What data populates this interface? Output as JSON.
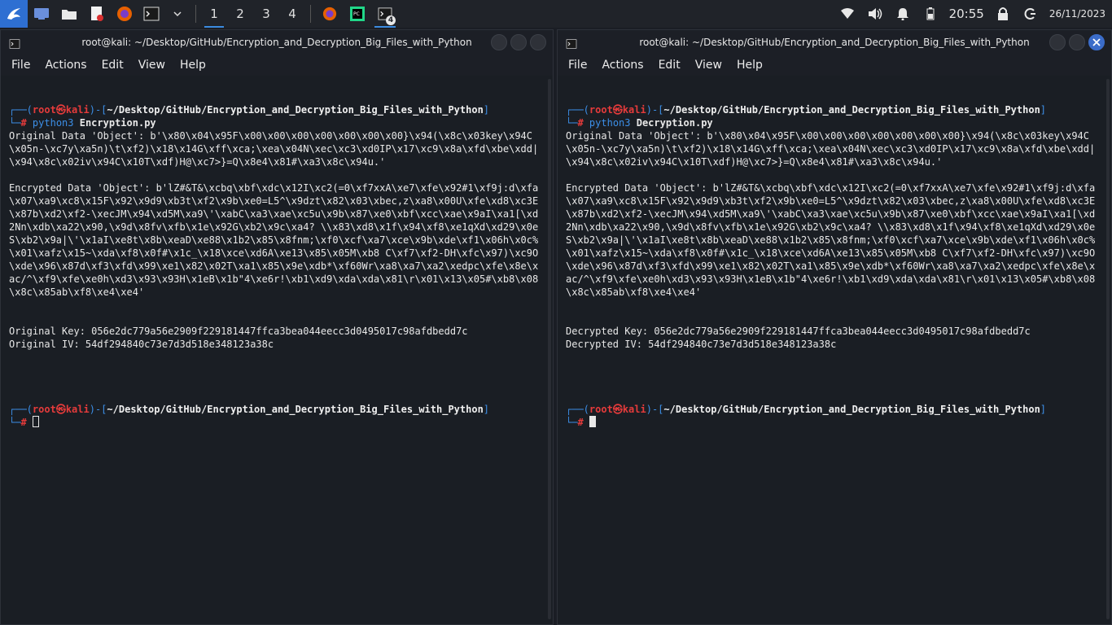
{
  "taskbar": {
    "workspaces": [
      "1",
      "2",
      "3",
      "4"
    ],
    "active_workspace": "1",
    "terminal_badge": "4",
    "clock": "20:55",
    "date": "26/11/2023"
  },
  "colors": {
    "taskbar_bg": "#202329",
    "terminal_bg": "#1b1e25",
    "prompt_blue": "#3c8fe8",
    "prompt_red": "#e53b3b",
    "accent": "#3b6cc9"
  },
  "left": {
    "title": "root@kali: ~/Desktop/GitHub/Encryption_and_Decryption_Big_Files_with_Python",
    "menu": [
      "File",
      "Actions",
      "Edit",
      "View",
      "Help"
    ],
    "prompt_user": "root",
    "prompt_host": "kali",
    "prompt_path": "~/Desktop/GitHub/Encryption_and_Decryption_Big_Files_with_Python",
    "prompt_hash": "#",
    "cmd_program": "python3",
    "cmd_script": "Encryption.py",
    "original_data": "Original Data 'Object': b'\\x80\\x04\\x95F\\x00\\x00\\x00\\x00\\x00\\x00\\x00}\\x94(\\x8c\\x03key\\x94C \\x05n-\\xc7y\\xa5n)\\t\\xf2)\\x18\\x14G\\xff\\xca;\\xea\\x04N\\xec\\xc3\\xd0IP\\x17\\xc9\\x8a\\xfd\\xbe\\xdd|\\x94\\x8c\\x02iv\\x94C\\x10T\\xdf)H@\\xc7>}=Q\\x8e4\\x81#\\xa3\\x8c\\x94u.'",
    "encrypted_data": "Encrypted Data 'Object': b'lZ#&T&\\xcbq\\xbf\\xdc\\x12I\\xc2(=0\\xf7xxA\\xe7\\xfe\\x92#1\\xf9j:d\\xfa\\x07\\xa9\\xc8\\x15F\\x92\\x9d9\\xb3t\\xf2\\x9b\\xe0=L5^\\x9dzt\\x82\\x03\\xbec,z\\xa8\\x00U\\xfe\\xd8\\xc3E\\x87b\\xd2\\xf2-\\xecJM\\x94\\xd5M\\xa9\\'\\xabC\\xa3\\xae\\xc5u\\x9b\\x87\\xe0\\xbf\\xcc\\xae\\x9aI\\xa1[\\xd2Nn\\xdb\\xa22\\x90,\\x9d\\x8fv\\xfb\\x1e\\x92G\\xb2\\x9c\\xa4? \\\\x83\\xd8\\x1f\\x94\\xf8\\xe1qXd\\xd29\\x0eS\\xb2\\x9a|\\'\\x1aI\\xe8t\\x8b\\xeaD\\xe88\\x1b2\\x85\\x8fnm;\\xf0\\xcf\\xa7\\xce\\x9b\\xde\\xf1\\x06h\\x0c%\\x01\\xafz\\x15~\\xda\\xf8\\x0f#\\x1c_\\x18\\xce\\xd6A\\xe13\\x85\\x05M\\xb8 C\\xf7\\xf2-DH\\xfc\\x97)\\xc9O\\xde\\x96\\x87d\\xf3\\xfd\\x99\\xe1\\x82\\x02T\\xa1\\x85\\x9e\\xdb*\\xf60Wr\\xa8\\xa7\\xa2\\xedpc\\xfe\\x8e\\xac/^\\xf9\\xfe\\xe0h\\xd3\\x93\\x93H\\x1eB\\x1b\"4\\xe6r!\\xb1\\xd9\\xda\\xda\\x81\\r\\x01\\x13\\x05#\\xb8\\x08\\x8c\\x85ab\\xf8\\xe4\\xe4'",
    "key_line": "Original Key: 056e2dc779a56e2909f229181447ffca3bea044eecc3d0495017c98afdbedd7c",
    "iv_line": "Original IV: 54df294840c73e7d3d518e348123a38c"
  },
  "right": {
    "title": "root@kali: ~/Desktop/GitHub/Encryption_and_Decryption_Big_Files_with_Python",
    "menu": [
      "File",
      "Actions",
      "Edit",
      "View",
      "Help"
    ],
    "prompt_user": "root",
    "prompt_host": "kali",
    "prompt_path": "~/Desktop/GitHub/Encryption_and_Decryption_Big_Files_with_Python",
    "prompt_hash": "#",
    "cmd_program": "python3",
    "cmd_script": "Decryption.py",
    "original_data": "Original Data 'Object': b'\\x80\\x04\\x95F\\x00\\x00\\x00\\x00\\x00\\x00\\x00}\\x94(\\x8c\\x03key\\x94C \\x05n-\\xc7y\\xa5n)\\t\\xf2)\\x18\\x14G\\xff\\xca;\\xea\\x04N\\xec\\xc3\\xd0IP\\x17\\xc9\\x8a\\xfd\\xbe\\xdd|\\x94\\x8c\\x02iv\\x94C\\x10T\\xdf)H@\\xc7>}=Q\\x8e4\\x81#\\xa3\\x8c\\x94u.'",
    "encrypted_data": "Encrypted Data 'Object': b'lZ#&T&\\xcbq\\xbf\\xdc\\x12I\\xc2(=0\\xf7xxA\\xe7\\xfe\\x92#1\\xf9j:d\\xfa\\x07\\xa9\\xc8\\x15F\\x92\\x9d9\\xb3t\\xf2\\x9b\\xe0=L5^\\x9dzt\\x82\\x03\\xbec,z\\xa8\\x00U\\xfe\\xd8\\xc3E\\x87b\\xd2\\xf2-\\xecJM\\x94\\xd5M\\xa9\\'\\xabC\\xa3\\xae\\xc5u\\x9b\\x87\\xe0\\xbf\\xcc\\xae\\x9aI\\xa1[\\xd2Nn\\xdb\\xa22\\x90,\\x9d\\x8fv\\xfb\\x1e\\x92G\\xb2\\x9c\\xa4? \\\\x83\\xd8\\x1f\\x94\\xf8\\xe1qXd\\xd29\\x0eS\\xb2\\x9a|\\'\\x1aI\\xe8t\\x8b\\xeaD\\xe88\\x1b2\\x85\\x8fnm;\\xf0\\xcf\\xa7\\xce\\x9b\\xde\\xf1\\x06h\\x0c%\\x01\\xafz\\x15~\\xda\\xf8\\x0f#\\x1c_\\x18\\xce\\xd6A\\xe13\\x85\\x05M\\xb8 C\\xf7\\xf2-DH\\xfc\\x97)\\xc9O\\xde\\x96\\x87d\\xf3\\xfd\\x99\\xe1\\x82\\x02T\\xa1\\x85\\x9e\\xdb*\\xf60Wr\\xa8\\xa7\\xa2\\xedpc\\xfe\\x8e\\xac/^\\xf9\\xfe\\xe0h\\xd3\\x93\\x93H\\x1eB\\x1b\"4\\xe6r!\\xb1\\xd9\\xda\\xda\\x81\\r\\x01\\x13\\x05#\\xb8\\x08\\x8c\\x85ab\\xf8\\xe4\\xe4'",
    "key_line": "Decrypted Key: 056e2dc779a56e2909f229181447ffca3bea044eecc3d0495017c98afdbedd7c",
    "iv_line": "Decrypted IV: 54df294840c73e7d3d518e348123a38c"
  }
}
